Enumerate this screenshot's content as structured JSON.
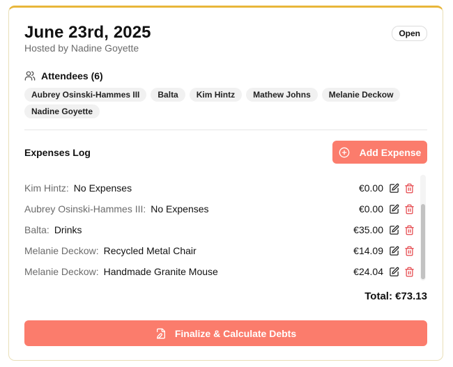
{
  "event": {
    "title": "June 23rd, 2025",
    "host": "Hosted by Nadine Goyette",
    "status": "Open"
  },
  "attendees": {
    "label": "Attendees (6)",
    "names": [
      "Aubrey Osinski-Hammes III",
      "Balta",
      "Kim Hintz",
      "Mathew Johns",
      "Melanie Deckow",
      "Nadine Goyette"
    ]
  },
  "expenses": {
    "title": "Expenses Log",
    "add_label": "Add Expense",
    "items": [
      {
        "person": "Kim Hintz:",
        "description": "No Expenses",
        "amount": "€0.00"
      },
      {
        "person": "Aubrey Osinski-Hammes III:",
        "description": "No Expenses",
        "amount": "€0.00"
      },
      {
        "person": "Balta:",
        "description": "Drinks",
        "amount": "€35.00"
      },
      {
        "person": "Melanie Deckow:",
        "description": "Recycled Metal Chair",
        "amount": "€14.09"
      },
      {
        "person": "Melanie Deckow:",
        "description": "Handmade Granite Mouse",
        "amount": "€24.04"
      }
    ],
    "total": "Total: €73.13"
  },
  "actions": {
    "finalize_label": "Finalize & Calculate Debts"
  },
  "colors": {
    "accent": "#fb7c6c",
    "top_border": "#e8b63a",
    "delete": "#e5484d"
  }
}
